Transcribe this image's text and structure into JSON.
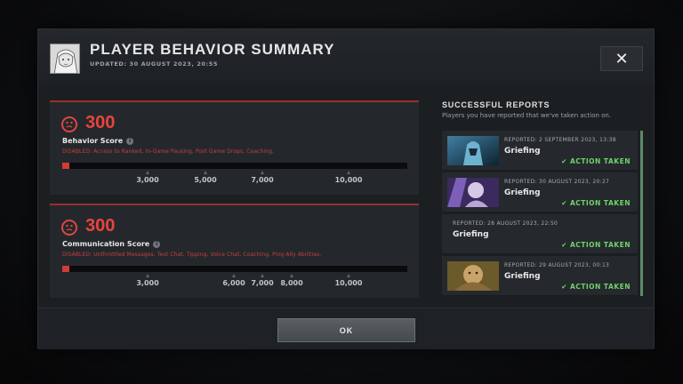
{
  "header": {
    "title": "PLAYER BEHAVIOR SUMMARY",
    "updated": "UPDATED: 30 AUGUST 2023, 20:55",
    "close_label": "✕"
  },
  "behavior": {
    "score": "300",
    "label": "Behavior Score",
    "disabled": "DISABLED:  Access to Ranked, In-Game Pausing, Post Game Drops, Coaching.",
    "progress_fraction": 0.02,
    "ticks": [
      "3,000",
      "5,000",
      "7,000",
      "10,000"
    ]
  },
  "communication": {
    "score": "300",
    "label": "Communication Score",
    "disabled": "DISABLED:  Unthrottled Messages, Text Chat, Tipping, Voice Chat, Coaching, Ping Ally Abilities.",
    "progress_fraction": 0.02,
    "ticks": [
      "3,000",
      "6,000",
      "7,000",
      "8,000",
      "10,000"
    ]
  },
  "reports": {
    "title": "SUCCESSFUL REPORTS",
    "subtitle": "Players you have reported that we've taken action on.",
    "items": [
      {
        "date": "REPORTED: 2 SEPTEMBER 2023, 13:38",
        "reason": "Griefing",
        "status": "✔ ACTION TAKEN",
        "portrait": "hero-portrait-phantom-assassin"
      },
      {
        "date": "REPORTED: 30 AUGUST 2023, 20:27",
        "reason": "Griefing",
        "status": "✔ ACTION TAKEN",
        "portrait": "hero-portrait-invoker"
      },
      {
        "date": "REPORTED: 28 AUGUST 2023, 22:50",
        "reason": "Griefing",
        "status": "✔ ACTION TAKEN",
        "portrait": ""
      },
      {
        "date": "REPORTED: 29 AUGUST 2023, 00:13",
        "reason": "Griefing",
        "status": "✔ ACTION TAKEN",
        "portrait": "hero-portrait-alchemist"
      }
    ]
  },
  "footer": {
    "ok_label": "OK"
  },
  "colors": {
    "accent_red": "#e8443d",
    "action_green": "#6fd36a",
    "panel": "#24282c"
  }
}
